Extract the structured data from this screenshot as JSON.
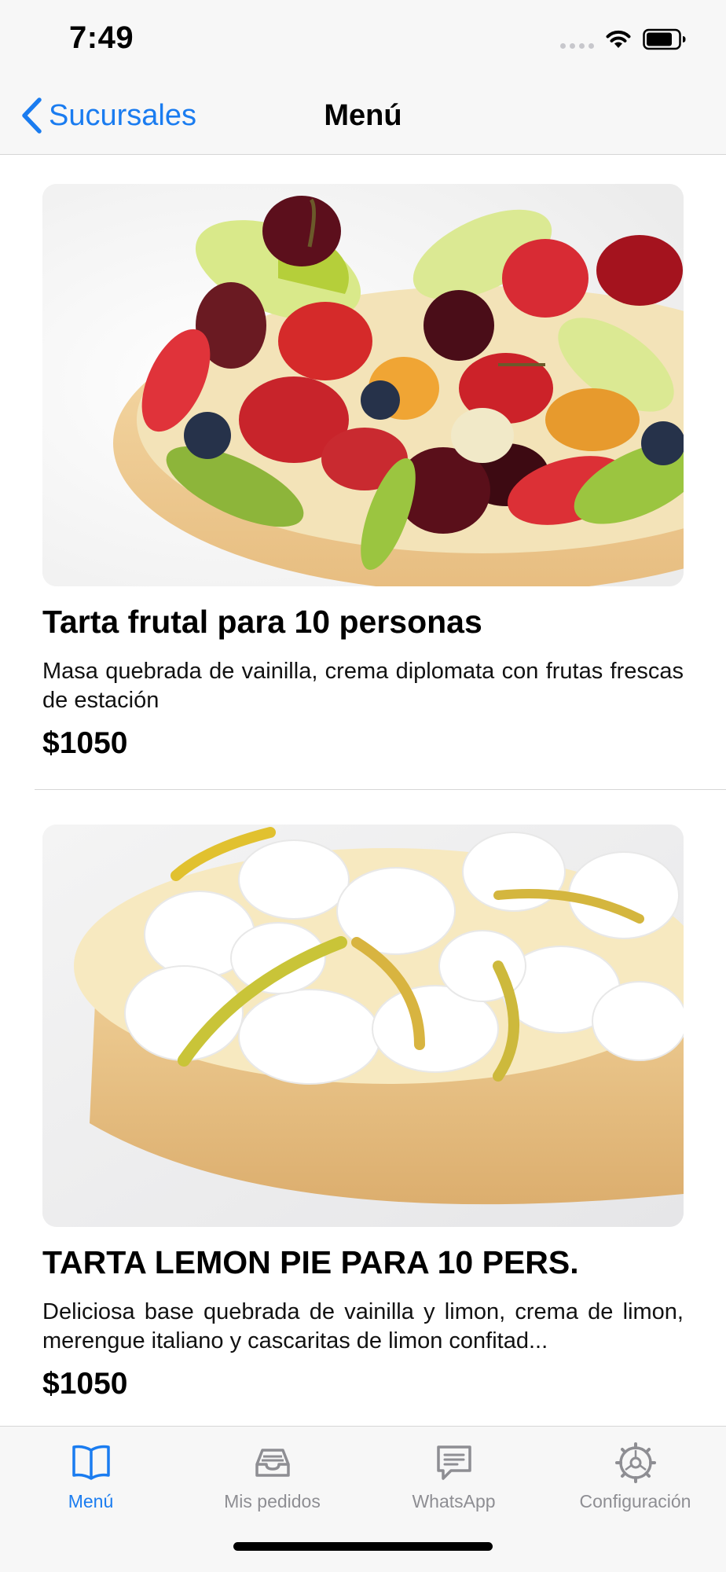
{
  "status_bar": {
    "time": "7:49"
  },
  "nav": {
    "back_label": "Sucursales",
    "title": "Menú"
  },
  "menu_items": [
    {
      "name": "Tarta frutal para 10 personas",
      "description": "Masa quebrada de vainilla, crema diplomata con frutas frescas de estación",
      "price": "$1050",
      "image": "fruit-tart-photo"
    },
    {
      "name": "TARTA LEMON PIE PARA 10 PERS.",
      "description": "Deliciosa base quebrada de vainilla y limon, crema de limon, merengue italiano y cascaritas de limon confitad...",
      "price": "$1050",
      "image": "lemon-pie-photo"
    }
  ],
  "tab_bar": {
    "tabs": [
      {
        "label": "Menú",
        "icon": "book-icon",
        "active": true
      },
      {
        "label": "Mis pedidos",
        "icon": "tray-icon",
        "active": false
      },
      {
        "label": "WhatsApp",
        "icon": "chat-bubble-icon",
        "active": false
      },
      {
        "label": "Configuración",
        "icon": "gear-icon",
        "active": false
      }
    ]
  },
  "colors": {
    "accent": "#1a7cf0",
    "inactive": "#8e8e93",
    "bar_background": "#f7f7f7"
  }
}
